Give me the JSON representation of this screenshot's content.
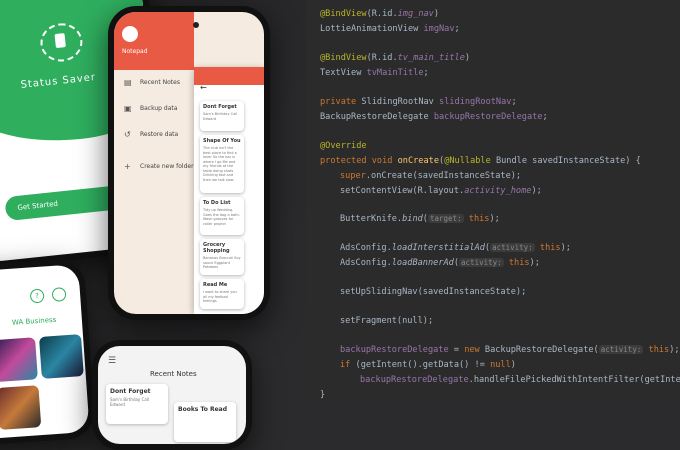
{
  "status_saver": {
    "title": "Status Saver",
    "button": "Get Started",
    "arrow": "➜"
  },
  "notepad": {
    "app_name": "Notepad",
    "menu": [
      {
        "icon": "▤",
        "label": "Recent Notes"
      },
      {
        "icon": "▣",
        "label": "Backup data"
      },
      {
        "icon": "↺",
        "label": "Restore data"
      },
      {
        "icon": "+",
        "label": "Create new folder"
      }
    ],
    "back": "←",
    "notes": [
      {
        "title": "Dont Forget",
        "body": "Sam's Birthday Call Edward"
      },
      {
        "title": "Shape Of You",
        "body": "The club isn't the best place to find a lover So the bar is where I go Me and my friends at the table doing shots Drinking fast and then we talk slow"
      },
      {
        "title": "To Do List",
        "body": "Tidy up Wedding. Goes the dog a bath. Wash grooves for caller project"
      },
      {
        "title": "Grocery Shopping",
        "body": "Bananas Broccoli Soy sauce Eggplant Potatoes"
      },
      {
        "title": "Read Me",
        "body": "I want to share you all my feelbad feelings"
      }
    ]
  },
  "wa": {
    "title": "WA Business",
    "q": "?"
  },
  "recent_notes": {
    "title": "Recent Notes",
    "menu": "☰",
    "notes": [
      {
        "title": "Dont Forget",
        "body": "Sam's Birthday Call Edward"
      },
      {
        "title": "Books To Read",
        "body": ""
      }
    ]
  },
  "code": {
    "l1a": "@BindView",
    "l1b": "(R.id.",
    "l1c": "img_nav",
    "l1d": ")",
    "l2a": "LottieAnimationView ",
    "l2b": "imgNav",
    ";": ";",
    "l3a": "@BindView",
    "l3b": "(R.id.",
    "l3c": "tv_main_title",
    "l3d": ")",
    "l4a": "TextView ",
    "l4b": "tvMainTitle",
    "l5a": "private ",
    "l5b": "SlidingRootNav ",
    "l5c": "slidingRootNav",
    "l6a": "BackupRestoreDelegate ",
    "l6b": "backupRestoreDelegate",
    "l7": "@Override",
    "l8a": "protected void ",
    "l8b": "onCreate",
    "l8c": "(",
    "l8d": "@Nullable",
    " l8e": " Bundle savedInstanceState) {",
    "l8e": " Bundle savedInstanceState) {",
    "l9a": "super",
    ".l9b": ".onCreate(savedInstanceState);",
    "l9b": ".onCreate(savedInstanceState);",
    "l10a": "setContentView(R.layout.",
    "l10b": "activity_home",
    "l10c": ");",
    "l11a": "ButterKnife.",
    "l11b": "bind",
    "l11c": "(",
    "l11h": "target:",
    "l11d": " this",
    ");": ");",
    "l11e": ");",
    "l12a": "AdsConfig.",
    "l12b": "loadInterstitialAd",
    "l12c": "(",
    "l12h": "activity:",
    "l12d": " this",
    "l12e": ");",
    "l13a": "AdsConfig.",
    "l13b": "loadBannerAd",
    "l13c": "(",
    "l13h": "activity:",
    "l13d": " this",
    "l13e": ");",
    "l14": "setUpSlidingNav(savedInstanceState);",
    "l15": "setFragment(null);",
    "l16a": "backupRestoreDelegate",
    " l16b": "",
    "l16b": " = ",
    "l16c": "new ",
    "l16d": "BackupRestoreDelegate(",
    "l16h": "activity:",
    "l16e": " this",
    "l16f": ");",
    "l17a": "if ",
    "l17b": "(getIntent().getData() != ",
    "l17c": "null",
    ")": ")",
    "l17d": ")",
    "l18a": "backupRestoreDelegate",
    ".l18b": "",
    "l18b": ".handleFilePickedWithIntentFilter(getIntent(",
    "l19": "}"
  }
}
